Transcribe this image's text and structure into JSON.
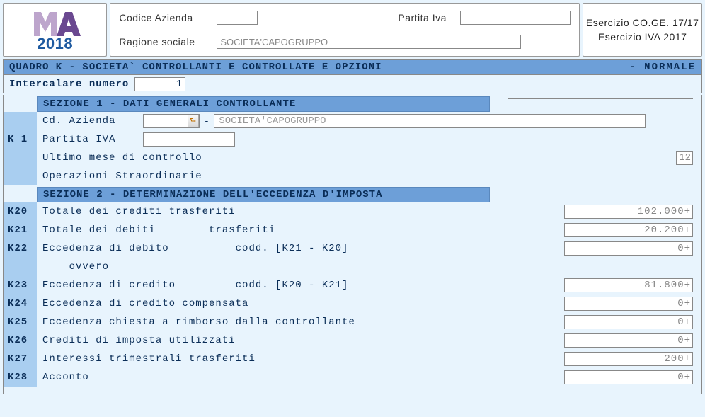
{
  "header": {
    "logo_year": "2018",
    "codice_label": "Codice  Azienda",
    "codice_value": "",
    "piva_label": "Partita Iva",
    "piva_value": "",
    "ragione_label": "Ragione sociale",
    "ragione_value": "SOCIETA'CAPOGRUPPO",
    "esercizio_coge": "Esercizio CO.GE. 17/17",
    "esercizio_iva": "Esercizio IVA 2017"
  },
  "title": {
    "left": "QUADRO K - SOCIETA` CONTROLLANTI E CONTROLLATE E OPZIONI",
    "right": "-  NORMALE"
  },
  "intercalare": {
    "label": "Intercalare numero",
    "value": "1"
  },
  "sezione1": {
    "header": "SEZIONE 1 - DATI GENERALI CONTROLLANTE",
    "code": "K 1",
    "cd_azienda_label": "Cd. Azienda",
    "cd_azienda_value": "",
    "company_name": "SOCIETA'CAPOGRUPPO",
    "piva_label": "Partita IVA",
    "piva_value": "",
    "ultimo_mese_label": "Ultimo mese di controllo",
    "ultimo_mese_value": "12",
    "operazioni_label": "Operazioni Straordinarie",
    "operazioni_value": ""
  },
  "sezione2": {
    "header": "SEZIONE 2 - DETERMINAZIONE DELL'ECCEDENZA D'IMPOSTA",
    "rows": [
      {
        "code": "K20",
        "label": "Totale dei crediti trasferiti",
        "value": "102.000+"
      },
      {
        "code": "K21",
        "label": "Totale dei debiti        trasferiti",
        "value": "20.200+"
      },
      {
        "code": "K22",
        "label": "Eccedenza di debito          codd. [K21 - K20]",
        "value": "0+"
      },
      {
        "code": "",
        "label": "    ovvero",
        "value": ""
      },
      {
        "code": "K23",
        "label": "Eccedenza di credito         codd. [K20 - K21]",
        "value": "81.800+"
      },
      {
        "code": "K24",
        "label": "Eccedenza di credito compensata",
        "value": "0+"
      },
      {
        "code": "K25",
        "label": "Eccedenza chiesta a rimborso dalla controllante",
        "value": "0+"
      },
      {
        "code": "K26",
        "label": "Crediti di imposta utilizzati",
        "value": "0+"
      },
      {
        "code": "K27",
        "label": "Interessi trimestrali trasferiti",
        "value": "200+"
      },
      {
        "code": "K28",
        "label": "Acconto",
        "value": "0+"
      }
    ]
  }
}
